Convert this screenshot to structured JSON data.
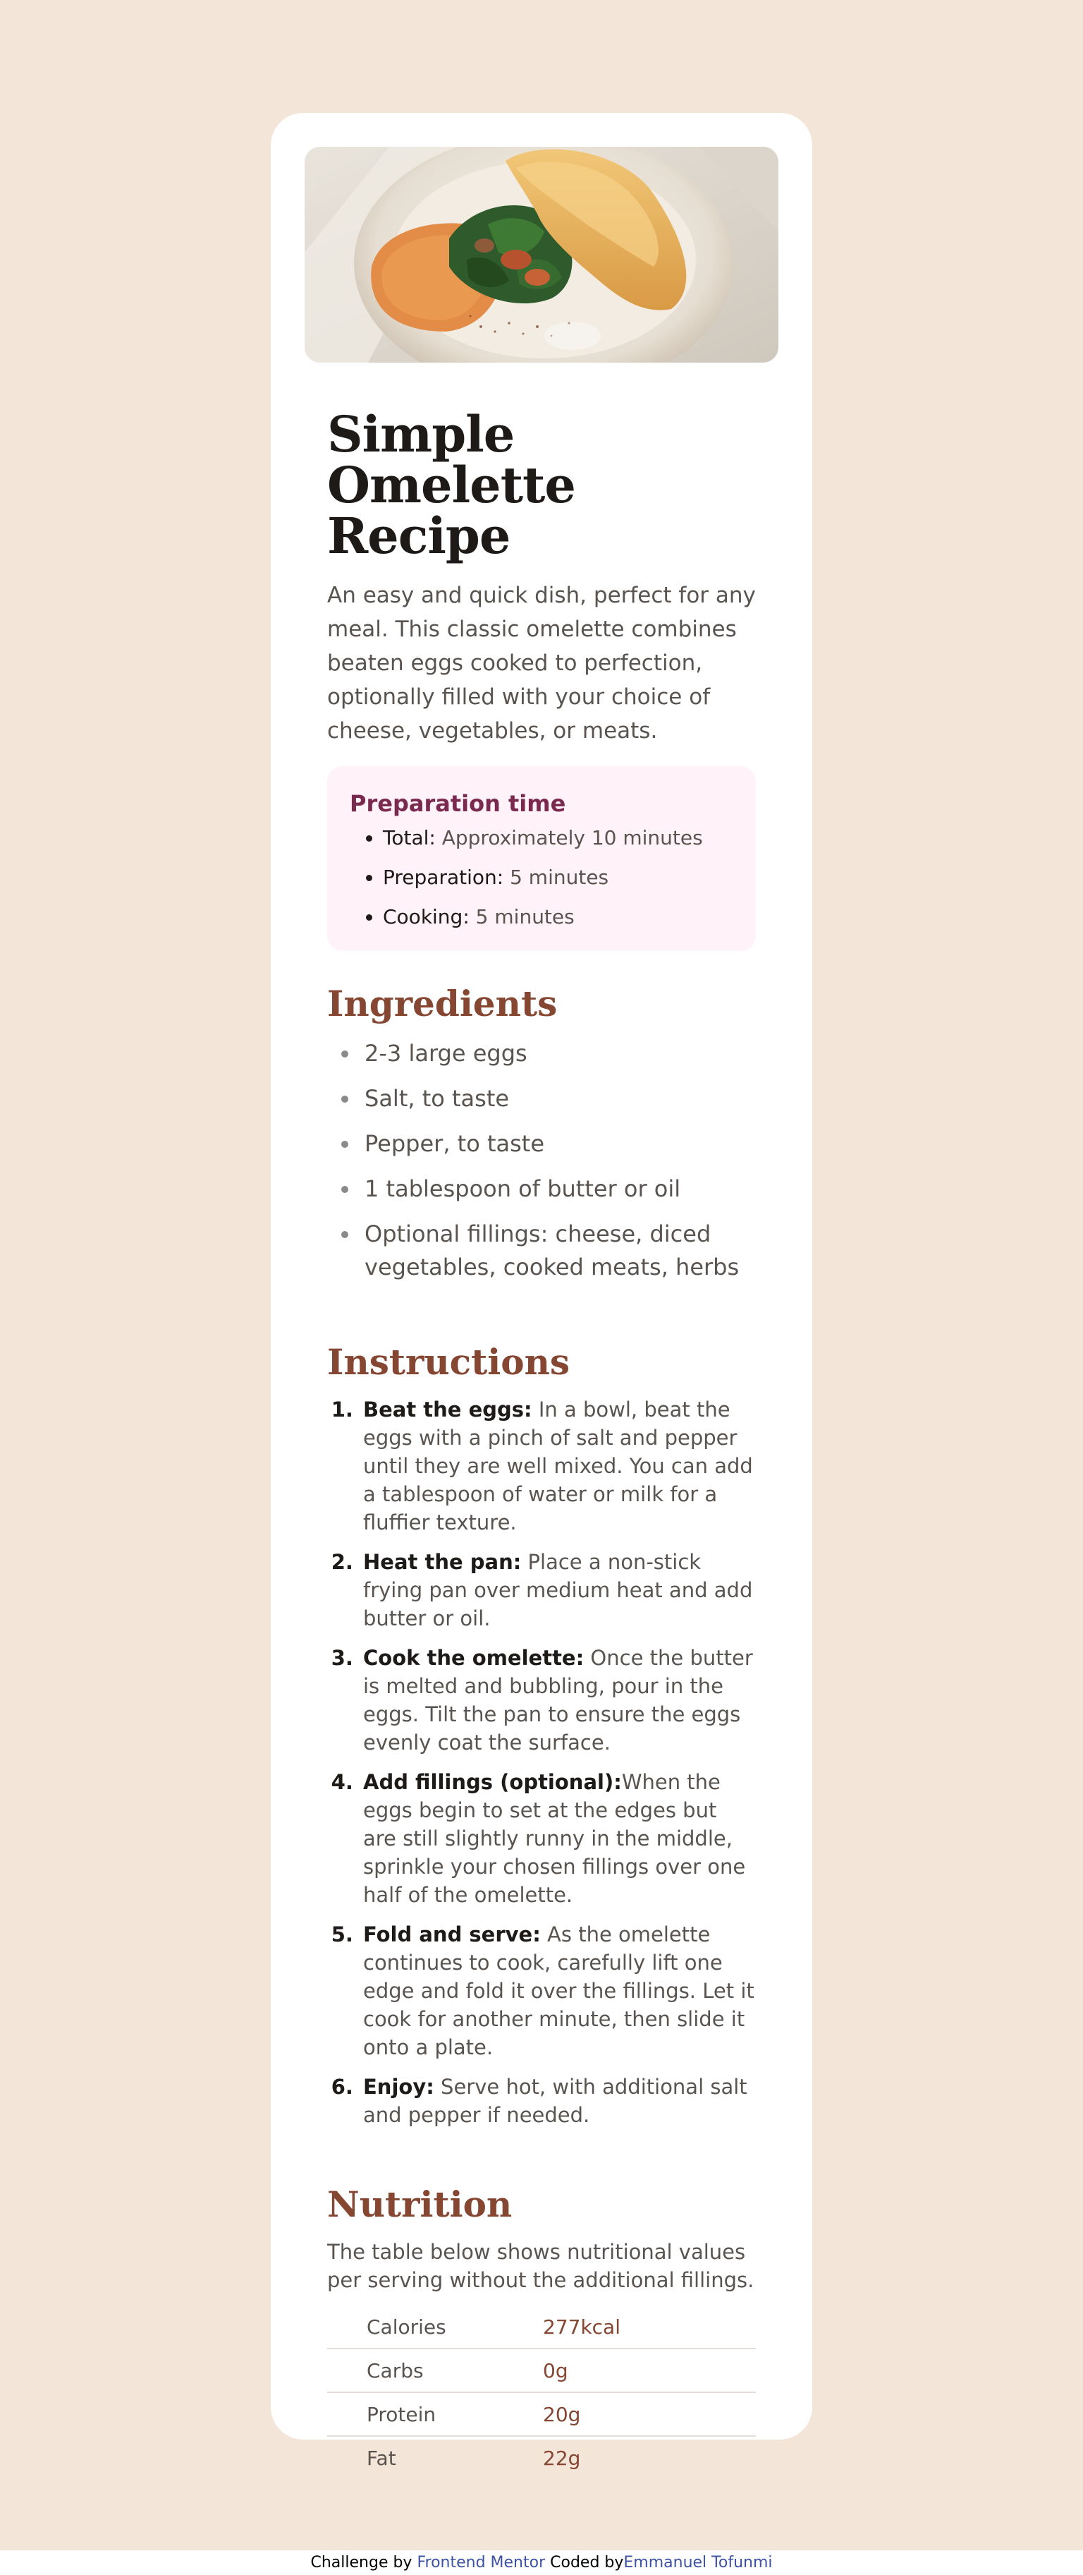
{
  "recipe": {
    "title": "Simple Omelette Recipe",
    "description": "An easy and quick dish, perfect for any meal. This classic omelette combines beaten eggs cooked to perfection, optionally filled with your choice of cheese, vegetables, or meats.",
    "preparation": {
      "heading": "Preparation time",
      "items": [
        {
          "label": "Total:",
          "value": "Approximately 10 minutes"
        },
        {
          "label": "Preparation:",
          "value": "5 minutes"
        },
        {
          "label": "Cooking:",
          "value": "5 minutes"
        }
      ]
    },
    "ingredients": {
      "heading": "Ingredients",
      "items": [
        "2-3 large eggs",
        "Salt, to taste",
        "Pepper, to taste",
        "1 tablespoon of butter or oil",
        "Optional fillings: cheese, diced vegetables, cooked meats, herbs"
      ]
    },
    "instructions": {
      "heading": "Instructions",
      "steps": [
        {
          "title": "Beat the eggs:",
          "text": " In a bowl, beat the eggs with a pinch of salt and pepper until they are well mixed. You can add a tablespoon of water or milk for a fluffier texture."
        },
        {
          "title": "Heat the pan:",
          "text": " Place a non-stick frying pan over medium heat and add butter or oil."
        },
        {
          "title": "Cook the omelette:",
          "text": " Once the butter is melted and bubbling, pour in the eggs. Tilt the pan to ensure the eggs evenly coat the surface."
        },
        {
          "title": "Add fillings (optional):",
          "text": "When the eggs begin to set at the edges but are still slightly runny in the middle, sprinkle your chosen fillings over one half of the omelette."
        },
        {
          "title": "Fold and serve:",
          "text": " As the omelette continues to cook, carefully lift one edge and fold it over the fillings. Let it cook for another minute, then slide it onto a plate."
        },
        {
          "title": "Enjoy:",
          "text": " Serve hot, with additional salt and pepper if needed."
        }
      ]
    },
    "nutrition": {
      "heading": "Nutrition",
      "intro": "The table below shows nutritional values per serving without the additional fillings.",
      "rows": [
        {
          "label": "Calories",
          "value": "277kcal"
        },
        {
          "label": "Carbs",
          "value": "0g"
        },
        {
          "label": "Protein",
          "value": "20g"
        },
        {
          "label": "Fat",
          "value": "22g"
        }
      ]
    }
  },
  "attribution": {
    "prefix": "Challenge by ",
    "challenge_link": "Frontend Mentor",
    "coded_by": " Coded by",
    "author_link": "Emmanuel Tofunmi"
  },
  "colors": {
    "page_background": "#f3e5d8",
    "card_background": "#ffffff",
    "accent_brown": "#854632",
    "accent_plum": "#7a2a4f",
    "prep_background": "#fff2f8",
    "link_blue": "#3e52a3"
  }
}
